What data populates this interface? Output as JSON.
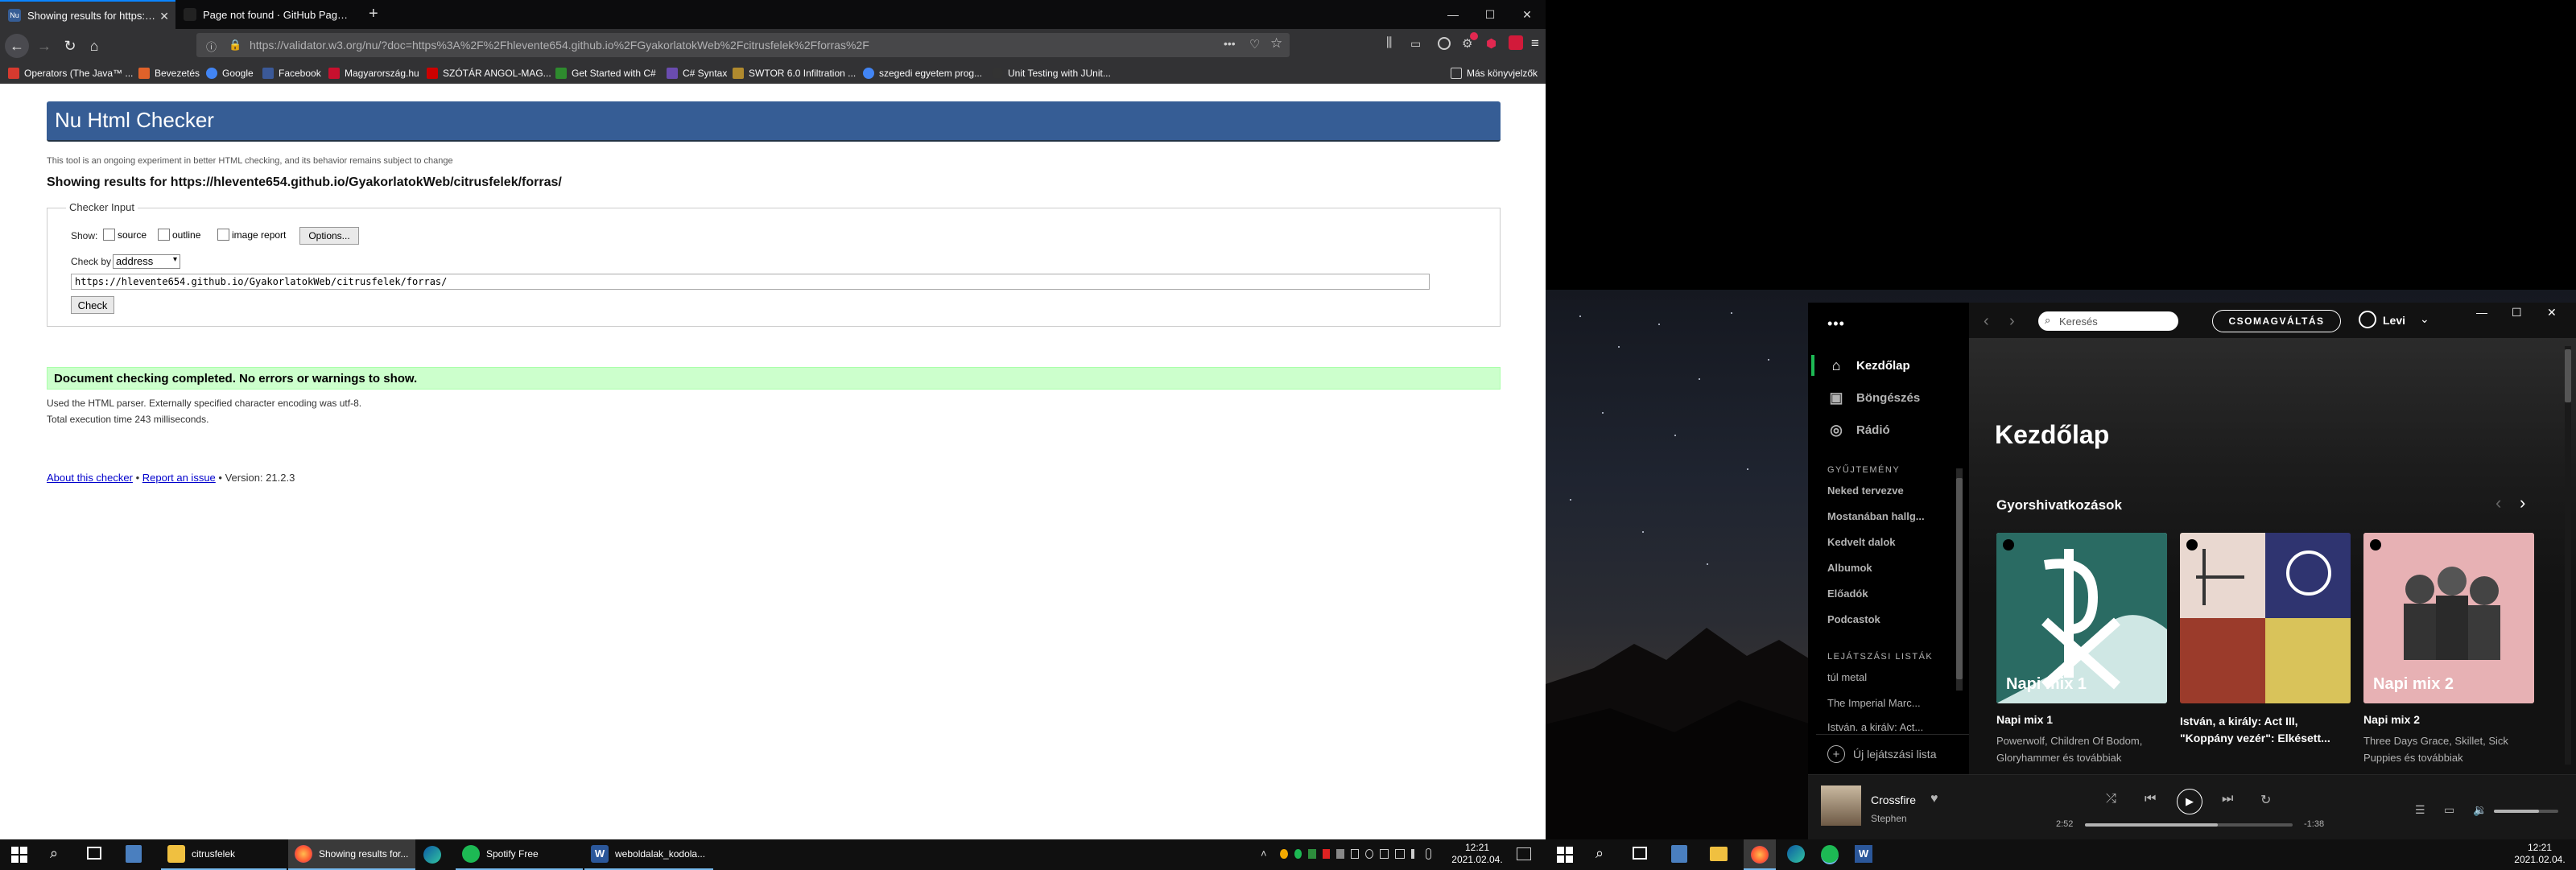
{
  "browser": {
    "tabs": [
      {
        "label": "Showing results for https://hle"
      },
      {
        "label": "Page not found · GitHub Pages"
      }
    ],
    "new_tab": "+",
    "url": "https://validator.w3.org/nu/?doc=https%3A%2F%2Fhlevente654.github.io%2FGyakorlatokWeb%2Fcitrusfelek%2Fforras%2F",
    "url_dots": "•••",
    "win_min": "—",
    "win_max": "☐",
    "win_close": "✕",
    "bookmarks": [
      {
        "label": "Operators (The Java™ ...",
        "color": "#d63a2f"
      },
      {
        "label": "Bevezetés",
        "color": "#e0622a"
      },
      {
        "label": "Google",
        "color": "#4285f4"
      },
      {
        "label": "Facebook",
        "color": "#3b5998"
      },
      {
        "label": "Magyarország.hu",
        "color": "#c8102e"
      },
      {
        "label": "SZÓTÁR ANGOL-MAG...",
        "color": "#cc0000"
      },
      {
        "label": "Get Started with C#",
        "color": "#2e8b2e"
      },
      {
        "label": "C# Syntax",
        "color": "#6a4caf"
      },
      {
        "label": "SWTOR 6.0 Infiltration ...",
        "color": "#b08a2e"
      },
      {
        "label": "szegedi egyetem prog...",
        "color": "#4285f4"
      },
      {
        "label": "Unit Testing with JUnit...",
        "color": "#333333"
      }
    ],
    "other_bookmarks": "Más könyvjelzők"
  },
  "checker": {
    "title": "Nu Html Checker",
    "subtitle": "This tool is an ongoing experiment in better HTML checking, and its behavior remains subject to change",
    "results_heading": "Showing results for https://hlevente654.github.io/GyakorlatokWeb/citrusfelek/forras/",
    "legend": "Checker Input",
    "show_label": "Show",
    "show_opts": [
      "source",
      "outline",
      "image report"
    ],
    "options_btn": "Options...",
    "check_by_label": "Check by",
    "check_by_value": "address",
    "address": "https://hlevente654.github.io/GyakorlatokWeb/citrusfelek/forras/",
    "check_btn": "Check",
    "success": "Document checking completed. No errors or warnings to show.",
    "parser_note": "Used the HTML parser. Externally specified character encoding was utf-8.",
    "exec_time": "Total execution time 243 milliseconds.",
    "footer_about": "About this checker",
    "footer_sep1": " • ",
    "footer_report": "Report an issue",
    "footer_version": " • Version: 21.2.3"
  },
  "taskbar_left": {
    "items": [
      {
        "label": "citrusfelek"
      },
      {
        "label": "Showing results for..."
      },
      {
        "label": ""
      },
      {
        "label": "Spotify Free"
      },
      {
        "label": "weboldalak_kodola..."
      }
    ],
    "time": "12:21",
    "date": "2021.02.04."
  },
  "spotify": {
    "nav": [
      {
        "label": "Kezdőlap",
        "icon": "home-icon",
        "active": true
      },
      {
        "label": "Böngészés",
        "icon": "browse-icon",
        "active": false
      },
      {
        "label": "Rádió",
        "icon": "radio-icon",
        "active": false
      }
    ],
    "library_heading": "GYŰJTEMÉNY",
    "library": [
      "Neked tervezve",
      "Mostanában hallg...",
      "Kedvelt dalok",
      "Albumok",
      "Előadók",
      "Podcastok"
    ],
    "playlists_heading": "LEJÁTSZÁSI LISTÁK",
    "playlists": [
      "túl metal",
      "The Imperial Marc...",
      "István, a király: Act..."
    ],
    "new_playlist": "Új lejátszási lista",
    "search_placeholder": "Keresés",
    "upgrade": "CSOMAGVÁLTÁS",
    "user": "Levi",
    "page_title": "Kezdőlap",
    "section": "Gyorshivatkozások",
    "cards": [
      {
        "cover_label": "Napi mix 1",
        "title": "Napi mix 1",
        "subtitle": "Powerwolf, Children Of Bodom, Gloryhammer és továbbiak",
        "color": "#2a6b63"
      },
      {
        "cover_label": "",
        "title": "István, a király: Act III, \"Koppány vezér\": Elkésett...",
        "subtitle": "",
        "color": "#7a2b20"
      },
      {
        "cover_label": "Napi mix 2",
        "title": "Napi mix 2",
        "subtitle": "Three Days Grace, Skillet, Sick Puppies és továbbiak",
        "color": "#e7b1b4"
      }
    ],
    "player": {
      "track": "Crossfire",
      "artist": "Stephen",
      "elapsed": "2:52",
      "remaining": "-1:38",
      "progress": 0.64,
      "volume": 0.7
    }
  },
  "taskbar_right": {
    "time": "12:21",
    "date": "2021.02.04."
  }
}
